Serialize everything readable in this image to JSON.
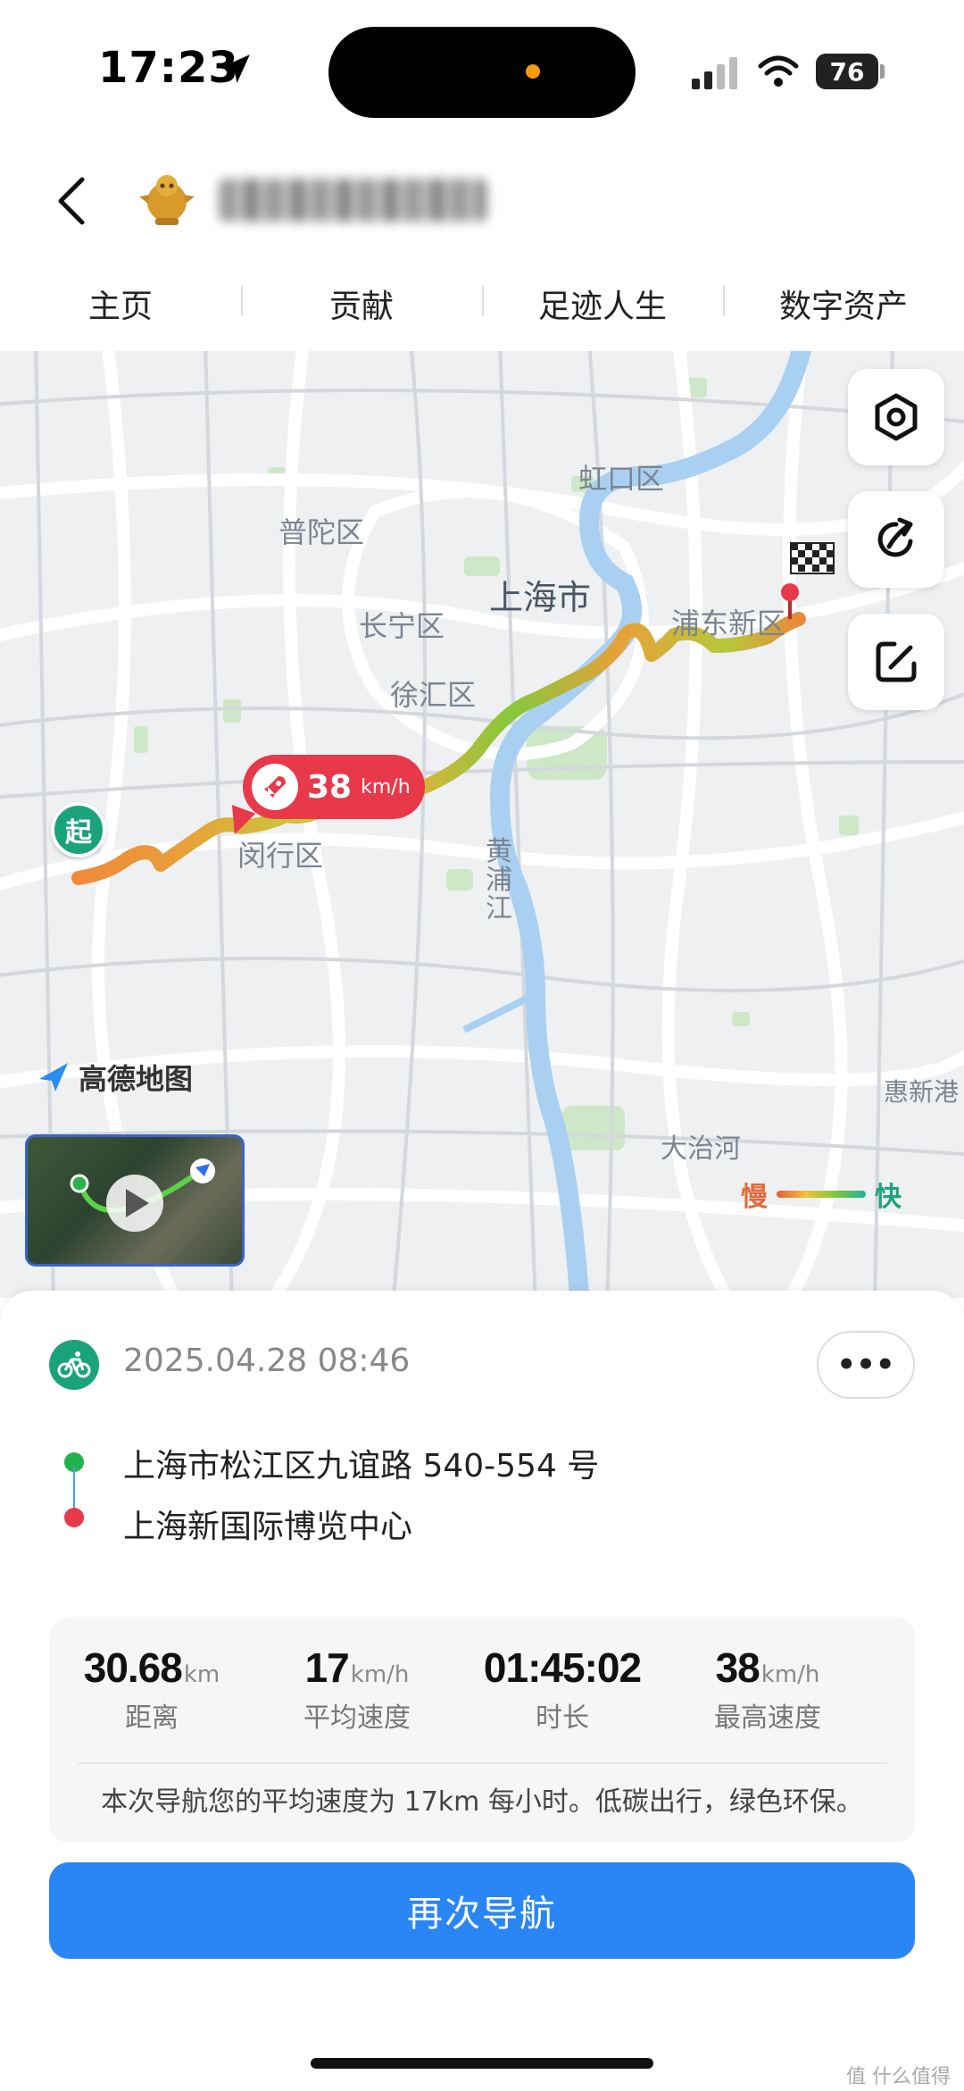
{
  "status_bar": {
    "time": "17:23",
    "battery": "76"
  },
  "header": {
    "back_label": "<"
  },
  "tabs": [
    {
      "label": "主页"
    },
    {
      "label": "贡献"
    },
    {
      "label": "足迹人生"
    },
    {
      "label": "数字资产"
    }
  ],
  "map": {
    "labels": {
      "hongkou": "虹口区",
      "putuo": "普陀区",
      "shanghai": "上海市",
      "changning": "长宁区",
      "pudong": "浦东新区",
      "xuhui": "徐汇区",
      "huangpu_river": "黄浦江",
      "minhang": "闵行区",
      "huinan": "惠新港",
      "datuan": "大治河"
    },
    "logo_text": "高德地图",
    "start_label": "起",
    "max_speed_bubble": {
      "value": "38",
      "unit": "km/h"
    },
    "legend": {
      "slow": "慢",
      "fast": "快"
    },
    "buttons": [
      "settings-icon",
      "share-icon",
      "edit-icon"
    ]
  },
  "trip": {
    "datetime": "2025.04.28 08:46",
    "more_label": "•••",
    "start_address": "上海市松江区九谊路 540-554 号",
    "end_address": "上海新国际博览中心"
  },
  "stats": [
    {
      "value": "30.68",
      "unit": "km",
      "label": "距离"
    },
    {
      "value": "17",
      "unit": "km/h",
      "label": "平均速度"
    },
    {
      "value": "01:45:02",
      "unit": "",
      "label": "时长"
    },
    {
      "value": "38",
      "unit": "km/h",
      "label": "最高速度"
    }
  ],
  "stats_note": "本次导航您的平均速度为 17km 每小时。低碳出行，绿色环保。",
  "navigate_again_label": "再次导航",
  "watermark": "值 什么值得买",
  "colors": {
    "accent": "#2b86f5",
    "brand_green": "#1aa37a",
    "red": "#e8394a"
  }
}
